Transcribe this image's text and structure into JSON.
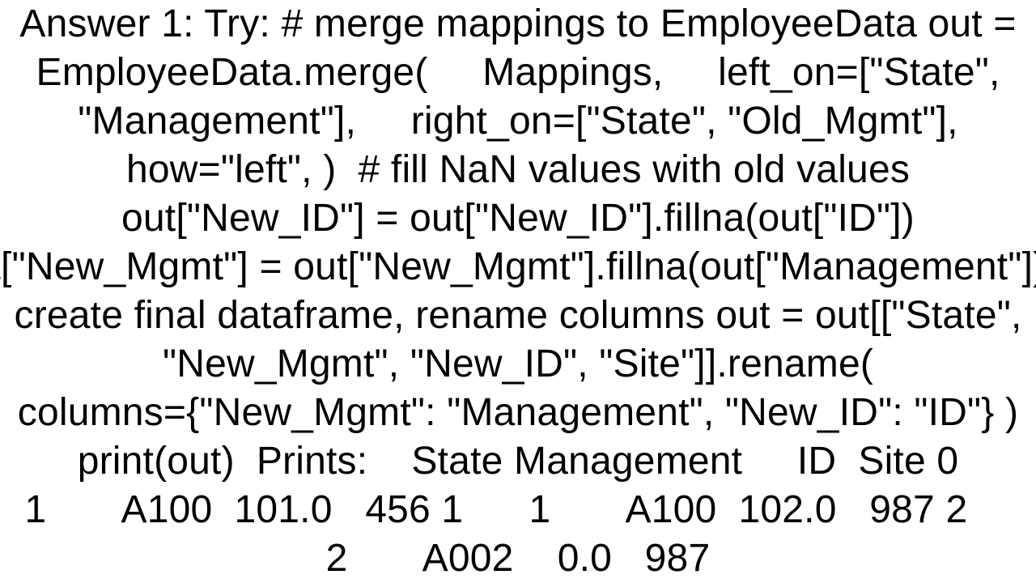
{
  "answer": {
    "label": "Answer 1:",
    "intro": "Try:",
    "code": {
      "comment1": "# merge mappings to EmployeeData",
      "line1": "out = EmployeeData.merge(     Mappings,     left_on=[\"State\", \"Management\"],     right_on=[\"State\", \"Old_Mgmt\"],     how=\"left\", )",
      "comment2": "# fill NaN values with old values",
      "line2": "out[\"New_ID\"] = out[\"New_ID\"].fillna(out[\"ID\"])",
      "line3": "out[\"New_Mgmt\"] = out[\"New_Mgmt\"].fillna(out[\"Management\"])",
      "comment3": "# create final dataframe, rename columns",
      "line4": "out = out[[\"State\", \"New_Mgmt\", \"New_ID\", \"Site\"]].rename(     columns={\"New_Mgmt\": \"Management\", \"New_ID\": \"ID\"} )",
      "line5": "print(out)"
    },
    "output_label": "Prints:",
    "output": {
      "header": "   State Management     ID  Site",
      "rows": [
        "0      1       A100  101.0   456",
        "1      1       A100  102.0   987",
        "2      2       A002    0.0   987"
      ]
    }
  },
  "display_lines": [
    "Answer 1: Try: # merge mappings to EmployeeData out =",
    "EmployeeData.merge(     Mappings,     left_on=[\"State\",",
    "\"Management\"],     right_on=[\"State\", \"Old_Mgmt\"],",
    "how=\"left\", )  # fill NaN values with old values",
    "out[\"New_ID\"] = out[\"New_ID\"].fillna(out[\"ID\"])",
    "out[\"New_Mgmt\"] = out[\"New_Mgmt\"].fillna(out[\"Management\"])  #",
    "create final dataframe, rename columns out = out[[\"State\",",
    "\"New_Mgmt\", \"New_ID\", \"Site\"]].rename(",
    "columns={\"New_Mgmt\": \"Management\", \"New_ID\": \"ID\"} )",
    "print(out)  Prints:    State Management     ID  Site 0",
    "1       A100  101.0   456 1      1       A100  102.0   987 2    ",
    "2       A002    0.0   987"
  ]
}
